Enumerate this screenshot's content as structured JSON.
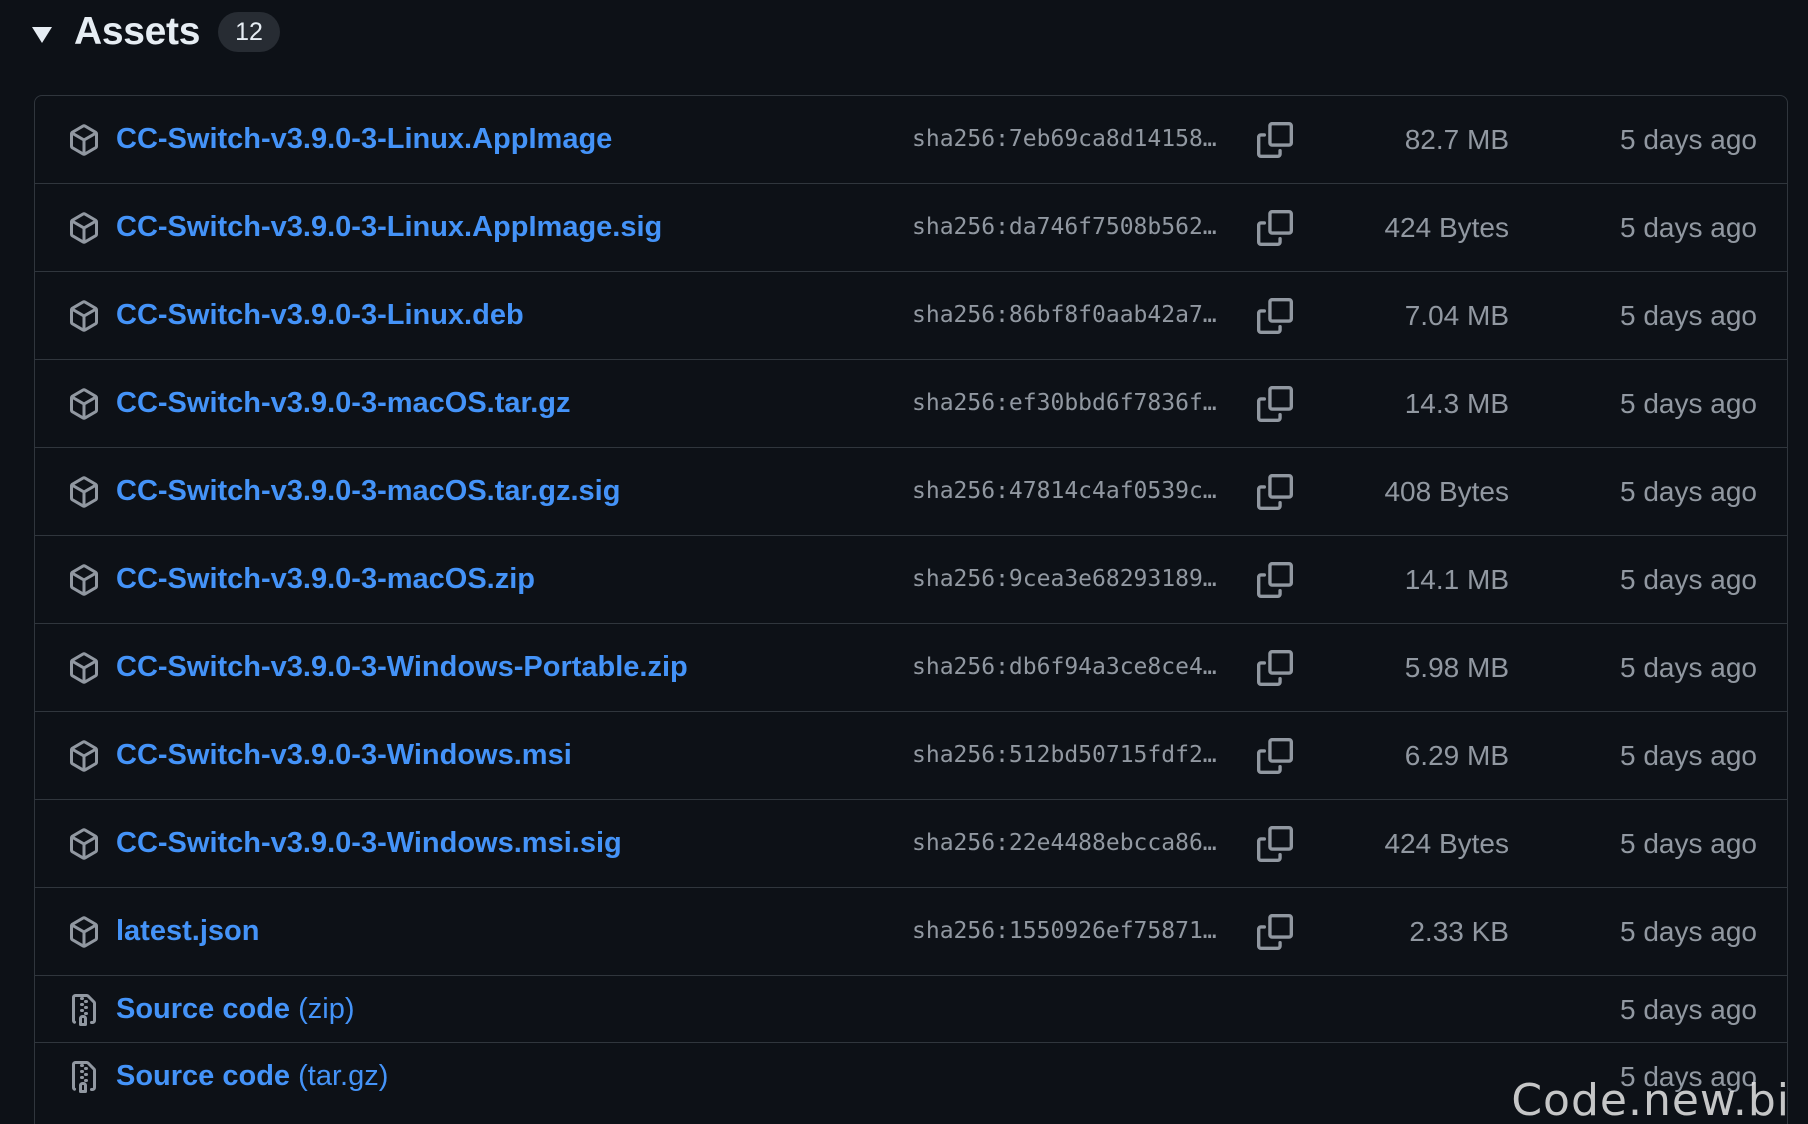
{
  "header": {
    "title": "Assets",
    "count": "12"
  },
  "assets": [
    {
      "name": "CC-Switch-v3.9.0-3-Linux.AppImage",
      "sha": "sha256:7eb69ca8d14158…",
      "size": "82.7 MB",
      "date": "5 days ago"
    },
    {
      "name": "CC-Switch-v3.9.0-3-Linux.AppImage.sig",
      "sha": "sha256:da746f7508b562…",
      "size": "424 Bytes",
      "date": "5 days ago"
    },
    {
      "name": "CC-Switch-v3.9.0-3-Linux.deb",
      "sha": "sha256:86bf8f0aab42a7…",
      "size": "7.04 MB",
      "date": "5 days ago"
    },
    {
      "name": "CC-Switch-v3.9.0-3-macOS.tar.gz",
      "sha": "sha256:ef30bbd6f7836f…",
      "size": "14.3 MB",
      "date": "5 days ago"
    },
    {
      "name": "CC-Switch-v3.9.0-3-macOS.tar.gz.sig",
      "sha": "sha256:47814c4af0539c…",
      "size": "408 Bytes",
      "date": "5 days ago"
    },
    {
      "name": "CC-Switch-v3.9.0-3-macOS.zip",
      "sha": "sha256:9cea3e68293189…",
      "size": "14.1 MB",
      "date": "5 days ago"
    },
    {
      "name": "CC-Switch-v3.9.0-3-Windows-Portable.zip",
      "sha": "sha256:db6f94a3ce8ce4…",
      "size": "5.98 MB",
      "date": "5 days ago"
    },
    {
      "name": "CC-Switch-v3.9.0-3-Windows.msi",
      "sha": "sha256:512bd50715fdf2…",
      "size": "6.29 MB",
      "date": "5 days ago"
    },
    {
      "name": "CC-Switch-v3.9.0-3-Windows.msi.sig",
      "sha": "sha256:22e4488ebcca86…",
      "size": "424 Bytes",
      "date": "5 days ago"
    },
    {
      "name": "latest.json",
      "sha": "sha256:1550926ef75871…",
      "size": "2.33 KB",
      "date": "5 days ago"
    }
  ],
  "source": [
    {
      "label": "Source code",
      "format": "(zip)",
      "date": "5 days ago"
    },
    {
      "label": "Source code",
      "format": "(tar.gz)",
      "date": "5 days ago"
    }
  ],
  "watermark": "Code.new.bi",
  "icons": {
    "asset": "package-icon",
    "copy": "copy-icon",
    "source": "file-zip-icon",
    "toggle": "triangle-down-icon"
  },
  "colors": {
    "background": "#0d1117",
    "link": "#4493f8",
    "muted": "#9198a1",
    "border": "#30363d"
  }
}
